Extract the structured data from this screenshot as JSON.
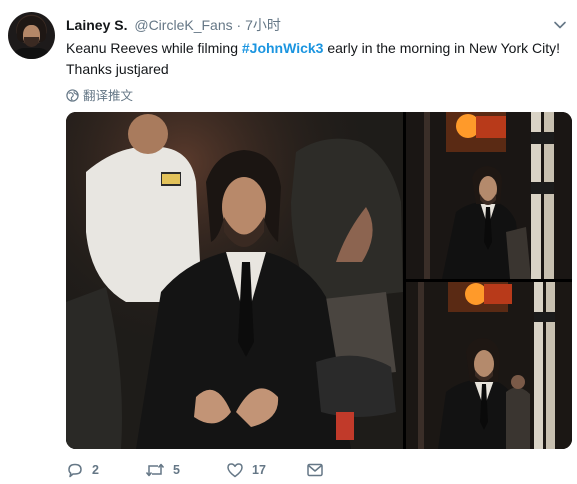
{
  "tweet": {
    "display_name": "Lainey S.",
    "handle": "@CircleK_Fans",
    "separator": "·",
    "time": "7小时",
    "text_before": "Keanu Reeves while filming ",
    "hashtag": "#JohnWick3",
    "text_after": " early in the morning in New York City! Thanks justjared",
    "translate_label": "翻译推文"
  },
  "actions": {
    "reply_count": "2",
    "retweet_count": "5",
    "like_count": "17"
  },
  "icons": {
    "avatar": "avatar-image",
    "caret": "chevron-down-icon",
    "translate": "globe-icon",
    "reply": "reply-icon",
    "retweet": "retweet-icon",
    "like": "heart-icon",
    "message": "envelope-icon"
  },
  "colors": {
    "hashtag": "#1b95e0",
    "secondary_text": "#657786"
  }
}
